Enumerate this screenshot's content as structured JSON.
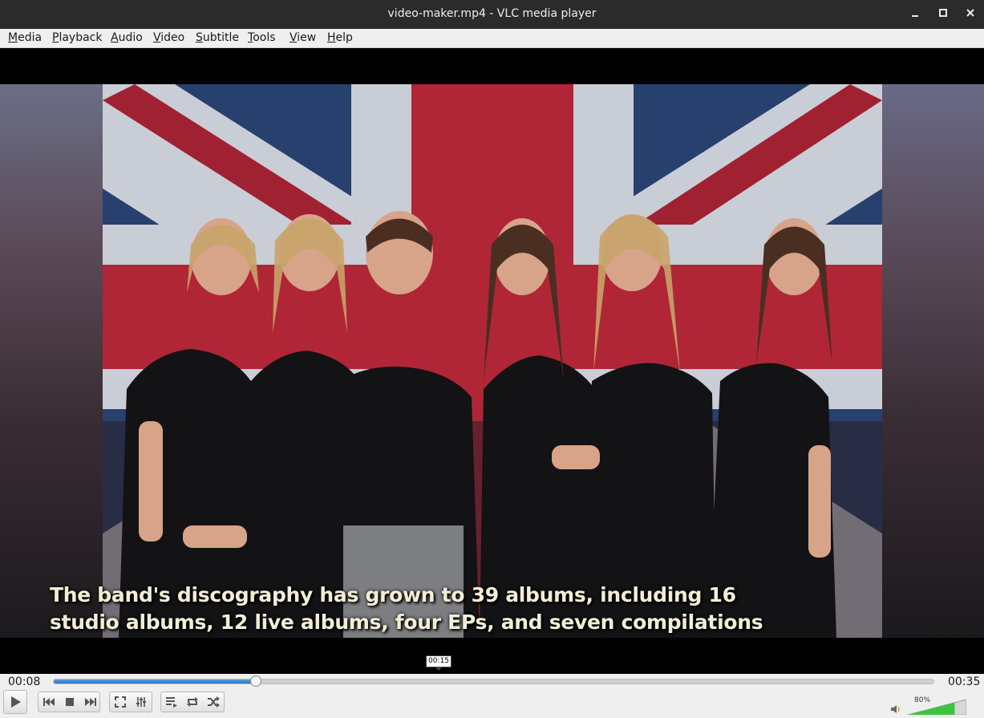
{
  "window": {
    "title": "video-maker.mp4 - VLC media player"
  },
  "menu": {
    "items": [
      {
        "label": "Media",
        "accel": "M"
      },
      {
        "label": "Playback",
        "accel": "P"
      },
      {
        "label": "Audio",
        "accel": "A"
      },
      {
        "label": "Video",
        "accel": "V"
      },
      {
        "label": "Subtitle",
        "accel": "S"
      },
      {
        "label": "Tools",
        "accel": "T"
      },
      {
        "label": "View",
        "accel": "V"
      },
      {
        "label": "Help",
        "accel": "H"
      }
    ]
  },
  "video": {
    "subtitle_line1": "The band's discography has grown to 39 albums, including 16",
    "subtitle_line2": "studio albums, 12 live albums, four EPs, and seven compilations"
  },
  "seek": {
    "elapsed": "00:08",
    "total": "00:35",
    "hover_tooltip": "00:15",
    "progress_fraction": 0.23
  },
  "volume": {
    "label": "80%",
    "level_fraction": 0.8
  },
  "icons": {
    "minimize": "minimize-icon",
    "maximize": "maximize-icon",
    "close": "close-icon",
    "play": "play-icon",
    "previous": "skip-previous-icon",
    "stop": "stop-icon",
    "next": "skip-next-icon",
    "fullscreen": "fullscreen-icon",
    "extended": "equalizer-icon",
    "playlist": "playlist-icon",
    "loop": "loop-icon",
    "shuffle": "shuffle-icon",
    "speaker": "speaker-icon"
  },
  "colors": {
    "seek_fill": "#3a82cc",
    "volume_fill": "#3cc43c"
  }
}
